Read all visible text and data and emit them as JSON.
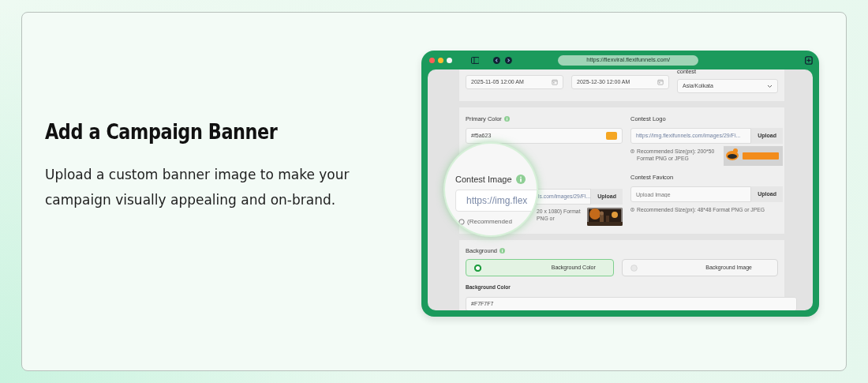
{
  "heading": "Add a Campaign Banner",
  "description": "Upload a custom banner image to make your campaign visually appealing and on-brand.",
  "browser": {
    "url": "https://flexviral.flexifunnels.com/"
  },
  "schedule": {
    "start": "2025-11-05 12:00 AM",
    "end": "2025-12-30 12:00 AM",
    "timezone_label": "contest",
    "timezone": "Asia/Kolkata"
  },
  "branding": {
    "primary_color": {
      "label": "Primary Color",
      "value": "#f5a623"
    },
    "logo": {
      "label": "Contest Logo",
      "value": "https://img.flexifunnels.com/images/29/Fi...",
      "button": "Upload",
      "hint": "Recommended Size(px): 200*50 Format PNG or JPEG"
    },
    "image": {
      "value": "ls.com/images/29/Fl...",
      "button": "Upload",
      "hint": "20 x 1080) Format PNG or"
    },
    "favicon": {
      "label": "Contest Favicon",
      "placeholder": "Upload Image",
      "button": "Upload",
      "hint": "Recommended Size(px): 48*48 Format PNG or JPEG"
    }
  },
  "background": {
    "label": "Background",
    "options": [
      {
        "label": "Background Color",
        "selected": true
      },
      {
        "label": "Background Image",
        "selected": false
      }
    ],
    "color_label": "Background Color",
    "color_value": "#F7F7F7"
  },
  "magnifier": {
    "label": "Contest Image",
    "value": "https://img.flex",
    "hint": "(Recommended"
  }
}
